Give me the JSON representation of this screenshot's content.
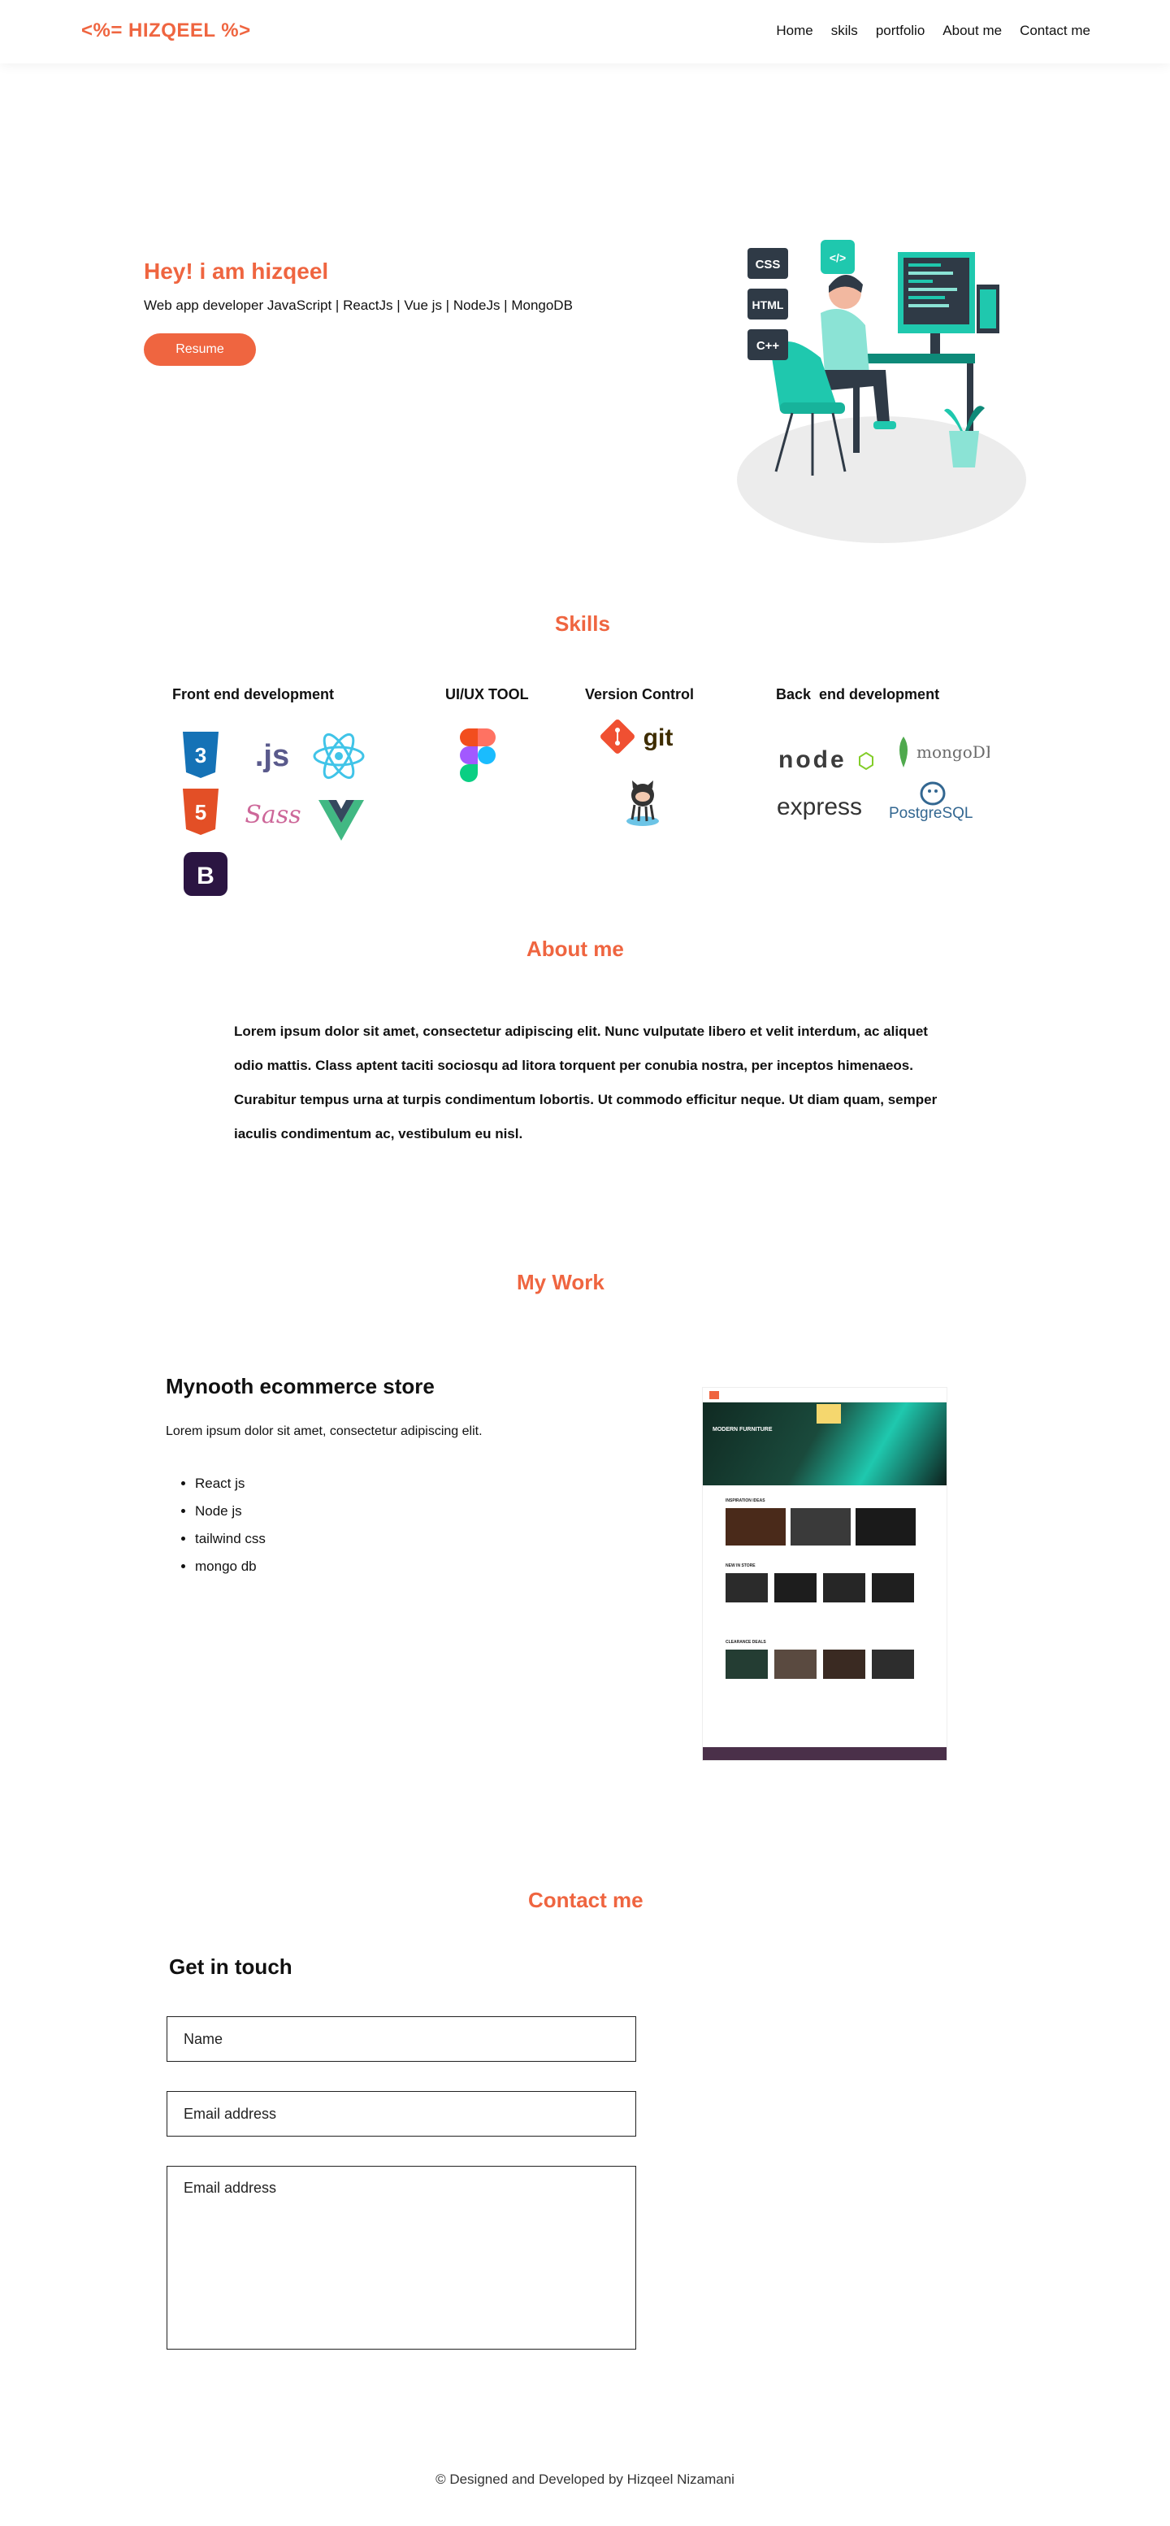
{
  "nav": {
    "logo": "<%= HIZQEEL  %>",
    "links": [
      "Home",
      "skils",
      "portfolio",
      "About me",
      "Contact me"
    ]
  },
  "hero": {
    "greeting": "Hey! i am hizqeel",
    "subtitle": "Web app developer JavaScript | ReactJs | Vue js | NodeJs | MongoDB",
    "resume_label": "Resume",
    "illustration_tags": [
      "CSS",
      "HTML",
      "C++",
      "</>"
    ]
  },
  "skills": {
    "title": "Skills",
    "groups": [
      {
        "heading": "Front end development",
        "icons": [
          "css3-icon",
          "js-icon",
          "react-icon",
          "html5-icon",
          "sass-icon",
          "vue-icon",
          "bootstrap-icon"
        ]
      },
      {
        "heading": "UI/UX TOOL",
        "icons": [
          "figma-icon"
        ]
      },
      {
        "heading": "Version Control",
        "icons": [
          "git-icon",
          "github-octocat-icon"
        ]
      },
      {
        "heading": "Back  end development",
        "icons": [
          "nodejs-icon",
          "mongodb-icon",
          "express-icon",
          "postgresql-icon"
        ]
      }
    ],
    "logo_texts": {
      "js": ".js",
      "git": "git",
      "node": "node",
      "mongo": "mongoDB",
      "express": "express",
      "postgres": "PostgreSQL",
      "bootstrap": "B",
      "sass": "Sass"
    }
  },
  "about": {
    "title": "About me",
    "text": "Lorem ipsum dolor sit amet, consectetur adipiscing elit. Nunc vulputate libero et velit interdum, ac aliquet odio mattis. Class aptent taciti sociosqu ad litora torquent per conubia nostra, per inceptos himenaeos. Curabitur tempus urna at turpis condimentum lobortis. Ut commodo efficitur neque. Ut diam quam, semper iaculis condimentum ac, vestibulum eu nisl."
  },
  "work": {
    "title": "My Work",
    "project_title": "Mynooth ecommerce store",
    "project_desc": "Lorem ipsum dolor sit amet, consectetur adipiscing elit.",
    "tech": [
      "React js",
      "Node js",
      "tailwind css",
      "mongo db"
    ],
    "screenshot_hero_text": "MODERN FURNITURE",
    "screenshot_sections": [
      "INSPIRATION IDEAS",
      "NEW IN STORE",
      "CLEARANCE DEALS"
    ]
  },
  "contact": {
    "title": "Contact me",
    "subtitle": "Get in touch",
    "name_placeholder": "Name",
    "email_placeholder": "Email address",
    "message_placeholder": "Email address"
  },
  "footer": {
    "text": "© Designed and Developed by Hizqeel Nizamani"
  },
  "colors": {
    "accent": "#ef6540",
    "teal": "#1fc8ae",
    "dark": "#2d3748"
  }
}
